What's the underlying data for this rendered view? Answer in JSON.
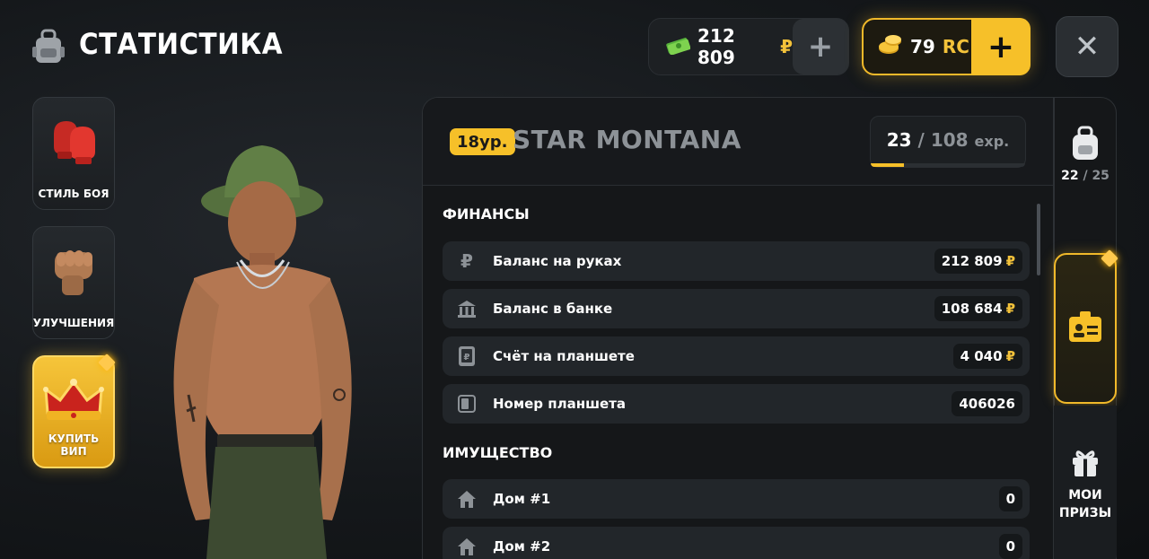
{
  "header": {
    "title": "СТАТИСТИКА",
    "money": {
      "amount": "212 809",
      "currency": "₽"
    },
    "rc": {
      "amount": "79",
      "currency": "RC"
    },
    "plus_symbol": "+",
    "close_symbol": "✕"
  },
  "left_menu": [
    {
      "label": "СТИЛЬ БОЯ",
      "icon": "boxing-gloves-icon"
    },
    {
      "label": "УЛУЧШЕНИЯ",
      "icon": "fist-icon"
    },
    {
      "label": "КУПИТЬ ВИП",
      "icon": "crown-icon"
    }
  ],
  "player": {
    "level_badge": "18ур.",
    "name": "STAR MONTANA",
    "exp_current": "23",
    "exp_sep": "/",
    "exp_max": "108",
    "exp_unit": "exp.",
    "exp_progress": 0.213
  },
  "finances": {
    "title": "ФИНАНСЫ",
    "rows": [
      {
        "label": "Баланс на руках",
        "value": "212 809",
        "currency": "₽",
        "icon": "ruble-icon"
      },
      {
        "label": "Баланс в банке",
        "value": "108 684",
        "currency": "₽",
        "icon": "bank-icon"
      },
      {
        "label": "Счёт на планшете",
        "value": "4 040",
        "currency": "₽",
        "icon": "tablet-icon"
      },
      {
        "label": "Номер планшета",
        "value": "406026",
        "currency": "",
        "icon": "tablet-number-icon"
      }
    ]
  },
  "property": {
    "title": "ИМУЩЕСТВО",
    "rows": [
      {
        "label": "Дом #1",
        "value": "0",
        "icon": "house-icon"
      },
      {
        "label": "Дом #2",
        "value": "0",
        "icon": "house-icon"
      }
    ]
  },
  "right_tabs": {
    "inventory": {
      "current": "22",
      "sep": "/",
      "max": "25",
      "icon": "backpack-icon"
    },
    "stats_icon": "id-card-icon",
    "prizes": {
      "line1": "МОИ",
      "line2": "ПРИЗЫ",
      "icon": "gift-icon"
    }
  },
  "colors": {
    "accent": "#f6c029",
    "rub": "#f3c23a",
    "panel": "#151719",
    "row": "#22262a"
  }
}
